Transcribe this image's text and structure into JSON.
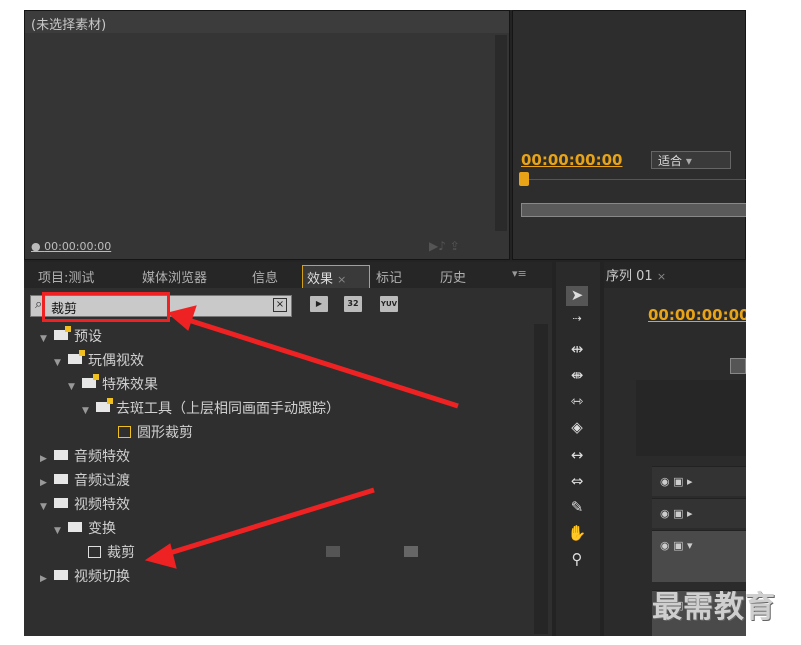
{
  "source_monitor": {
    "title": "(未选择素材)",
    "timecode": "00:00:00:00"
  },
  "program_monitor": {
    "timecode": "00:00:00:00",
    "fit": "适合"
  },
  "tabs": [
    "项目:测试",
    "媒体浏览器",
    "信息",
    "效果",
    "标记",
    "历史"
  ],
  "search": {
    "value": "裁剪"
  },
  "fx_buttons": [
    "accelerated",
    "32",
    "YUV"
  ],
  "tree": [
    {
      "label": "预设",
      "depth": 0,
      "open": true,
      "icon": "preset-folder"
    },
    {
      "label": "玩偶视效",
      "depth": 1,
      "open": true,
      "icon": "preset-folder"
    },
    {
      "label": "特殊效果",
      "depth": 2,
      "open": true,
      "icon": "preset-folder"
    },
    {
      "label": "去斑工具（上层相同画面手动跟踪）",
      "depth": 3,
      "open": true,
      "icon": "preset-folder"
    },
    {
      "label": "圆形裁剪",
      "depth": 4,
      "icon": "preset-effect"
    },
    {
      "label": "音频特效",
      "depth": 0,
      "open": false,
      "icon": "folder"
    },
    {
      "label": "音频过渡",
      "depth": 0,
      "open": false,
      "icon": "folder"
    },
    {
      "label": "视频特效",
      "depth": 0,
      "open": true,
      "icon": "folder"
    },
    {
      "label": "变换",
      "depth": 1,
      "open": true,
      "icon": "folder"
    },
    {
      "label": "裁剪",
      "depth": 2,
      "icon": "effect"
    },
    {
      "label": "视频切换",
      "depth": 0,
      "open": false,
      "icon": "folder"
    }
  ],
  "sequence": {
    "tab": "序列 01",
    "timecode": "00:00:00:00"
  },
  "watermark": "最需教育",
  "colors": {
    "accent": "#e8a317",
    "annotation": "#ee2222"
  }
}
